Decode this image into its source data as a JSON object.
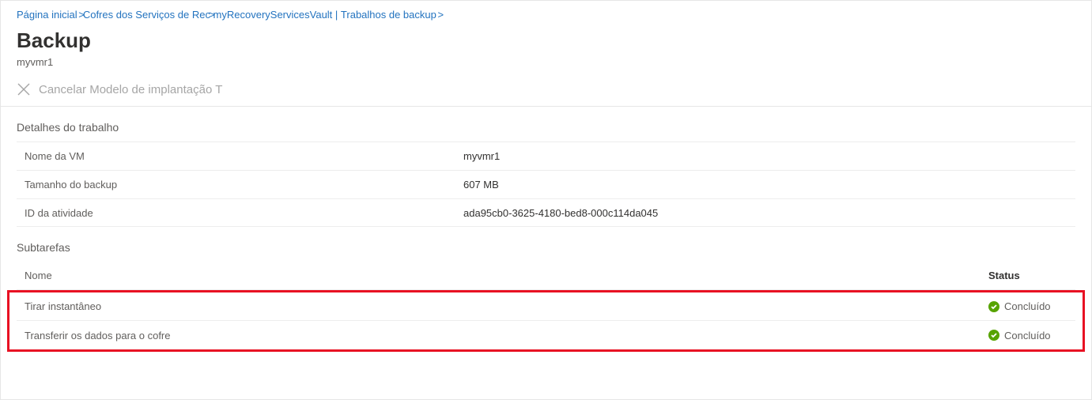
{
  "breadcrumb": {
    "crumb0": "Página inicial",
    "crumb1": "Cofres dos Serviços de Rec",
    "crumb2": "myRecoveryServicesVault |",
    "crumb3": "Trabalhos de backup"
  },
  "header": {
    "title": "Backup",
    "subtitle": "myvmr1"
  },
  "toolbar": {
    "cancel_label": "Cancelar Modelo de implantação T"
  },
  "details": {
    "section_label": "Detalhes do trabalho",
    "rows": [
      {
        "key": "Nome da VM",
        "value": "myvmr1"
      },
      {
        "key": "Tamanho do backup",
        "value": "607 MB"
      },
      {
        "key": "ID da atividade",
        "value": "ada95cb0-3625-4180-bed8-000c114da045"
      }
    ]
  },
  "subtasks": {
    "section_label": "Subtarefas",
    "col_name": "Nome",
    "col_status": "Status",
    "rows": [
      {
        "name": "Tirar instantâneo",
        "status": "Concluído"
      },
      {
        "name": "Transferir os dados para o cofre",
        "status": "Concluído"
      }
    ]
  }
}
